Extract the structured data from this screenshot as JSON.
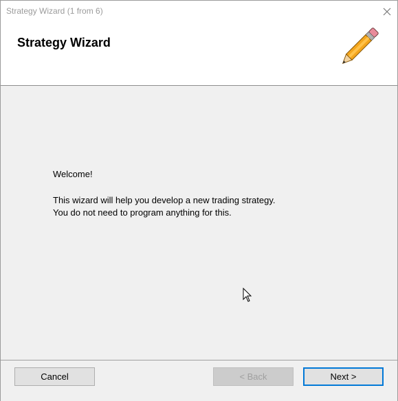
{
  "window": {
    "title": "Strategy Wizard (1 from 6)"
  },
  "header": {
    "title": "Strategy Wizard",
    "icon": "pencil-icon"
  },
  "content": {
    "welcome": "Welcome!",
    "description_lines": [
      "This wizard will help you develop a new trading strategy.",
      "You do not need to program anything for this."
    ]
  },
  "footer": {
    "cancel_label": "Cancel",
    "back_label": "< Back",
    "next_label": "Next >"
  },
  "colors": {
    "accent": "#0078d7",
    "panel_bg": "#f0f0f0",
    "header_bg": "#ffffff"
  }
}
